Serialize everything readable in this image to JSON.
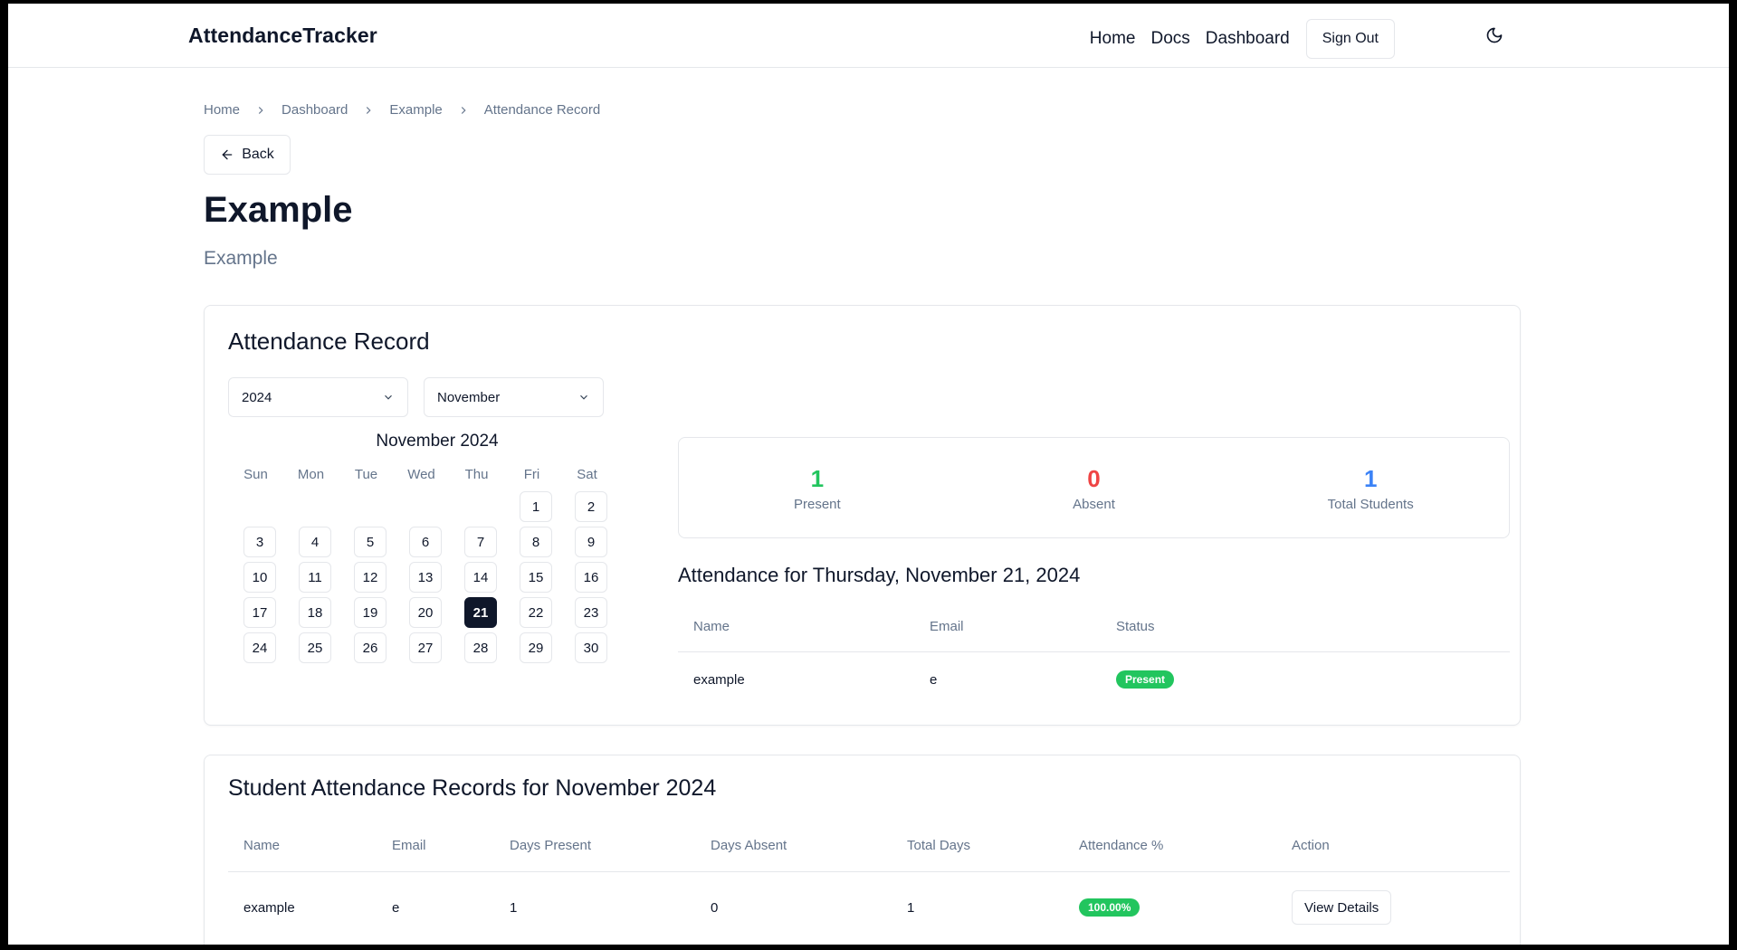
{
  "header": {
    "brand": "AttendanceTracker",
    "nav": [
      "Home",
      "Docs",
      "Dashboard"
    ],
    "sign_out": "Sign Out",
    "theme_icon": "moon-icon"
  },
  "breadcrumb": [
    "Home",
    "Dashboard",
    "Example",
    "Attendance Record"
  ],
  "back_label": "Back",
  "page": {
    "title": "Example",
    "subtitle": "Example"
  },
  "record": {
    "title": "Attendance Record",
    "year": "2024",
    "month": "November",
    "calendar": {
      "caption": "November 2024",
      "weekdays": [
        "Sun",
        "Mon",
        "Tue",
        "Wed",
        "Thu",
        "Fri",
        "Sat"
      ],
      "first_weekday": 5,
      "days_in_month": 30,
      "selected_day": 21
    },
    "stats": {
      "present": {
        "value": "1",
        "label": "Present",
        "color": "#22c55e"
      },
      "absent": {
        "value": "0",
        "label": "Absent",
        "color": "#ef4444"
      },
      "total": {
        "value": "1",
        "label": "Total Students",
        "color": "#3b82f6"
      }
    },
    "day_heading": "Attendance for Thursday, November 21, 2024",
    "day_table": {
      "columns": [
        "Name",
        "Email",
        "Status"
      ],
      "rows": [
        {
          "name": "example",
          "email": "e",
          "status": "Present"
        }
      ]
    }
  },
  "summary": {
    "title": "Student Attendance Records for November 2024",
    "columns": [
      "Name",
      "Email",
      "Days Present",
      "Days Absent",
      "Total Days",
      "Attendance %",
      "Action"
    ],
    "rows": [
      {
        "name": "example",
        "email": "e",
        "days_present": "1",
        "days_absent": "0",
        "total_days": "1",
        "attendance_pct": "100.00%",
        "action": "View Details"
      }
    ]
  },
  "colors": {
    "badge_green": "#22c55e",
    "text_dark": "#0f172a",
    "muted": "#64748b"
  }
}
